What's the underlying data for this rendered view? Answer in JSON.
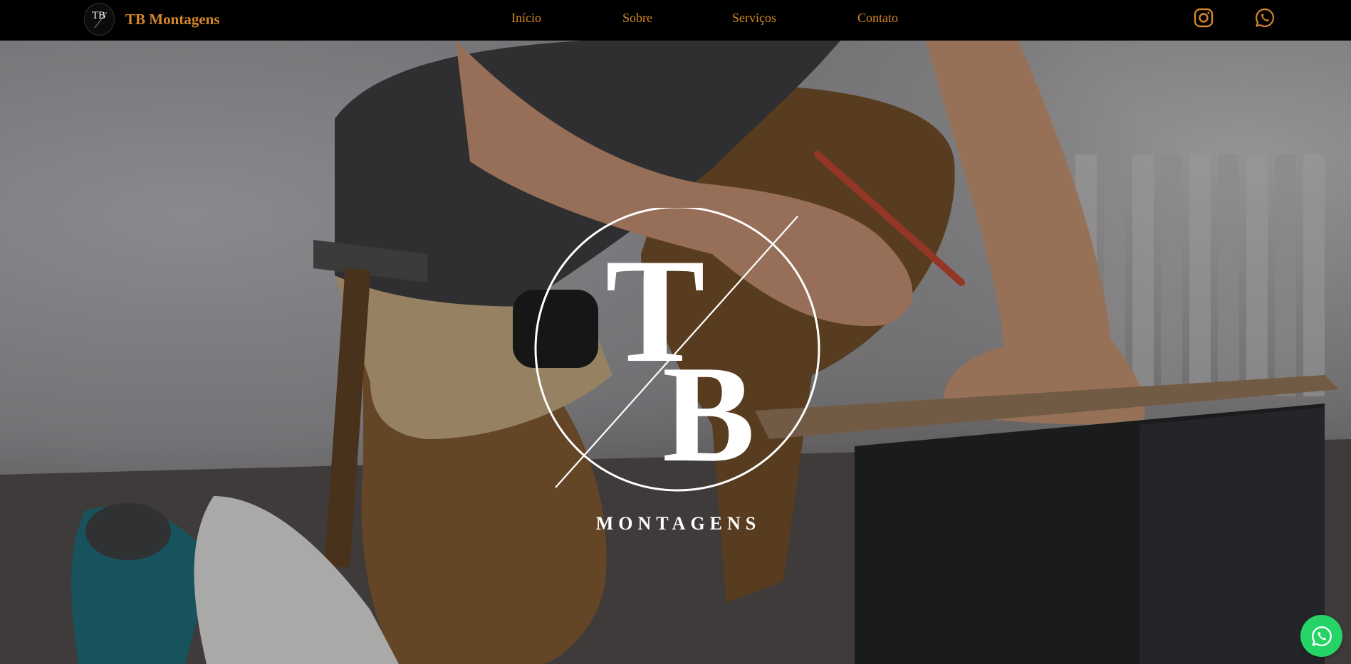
{
  "brand": {
    "logo_text": "TB",
    "name": "TB Montagens"
  },
  "nav": {
    "items": [
      {
        "label": "Início"
      },
      {
        "label": "Sobre"
      },
      {
        "label": "Serviços"
      },
      {
        "label": "Contato"
      }
    ]
  },
  "social": {
    "icons": [
      "instagram-icon",
      "whatsapp-icon"
    ]
  },
  "hero": {
    "logo_letter_t": "T",
    "logo_letter_b": "B",
    "logo_subtitle": "MONTAGENS"
  },
  "floating": {
    "icon": "whatsapp-icon"
  },
  "colors": {
    "nav_bg": "#000000",
    "accent": "#d4862a",
    "whatsapp_green": "#25d366",
    "logo_white": "#ffffff"
  }
}
